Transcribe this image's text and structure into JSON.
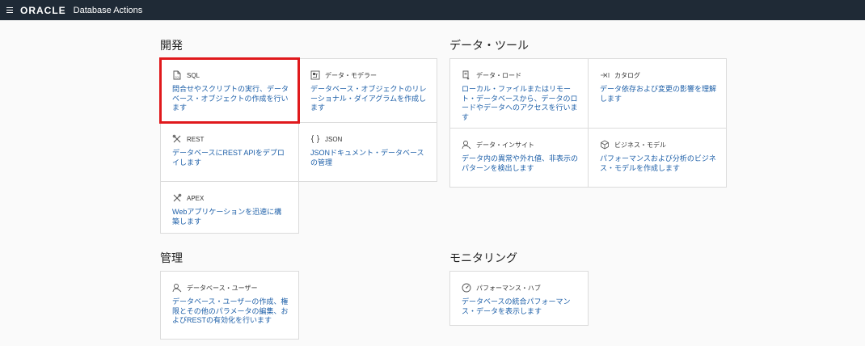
{
  "topbar": {
    "brand": "ORACLE",
    "app_title": "Database Actions"
  },
  "sections": {
    "development": {
      "title": "開発",
      "cards": [
        {
          "label": "SQL",
          "icon": "sql-file-icon",
          "desc": "問合せやスクリプトの実行、データベース・オブジェクトの作成を行います"
        },
        {
          "label": "データ・モデラー",
          "icon": "data-modeler-icon",
          "desc": "データベース・オブジェクトのリレーショナル・ダイアグラムを作成します"
        },
        {
          "label": "REST",
          "icon": "rest-tools-icon",
          "desc": "データベースにREST APIをデプロイします"
        },
        {
          "label": "JSON",
          "icon": "json-braces-icon",
          "desc": "JSONドキュメント・データベースの管理"
        },
        {
          "label": "APEX",
          "icon": "apex-tools-icon",
          "desc": "Webアプリケーションを迅速に構築します"
        }
      ]
    },
    "data_tools": {
      "title": "データ・ツール",
      "cards": [
        {
          "label": "データ・ロード",
          "icon": "data-load-icon",
          "desc": "ローカル・ファイルまたはリモート・データベースから、データのロードやデータへのアクセスを行います"
        },
        {
          "label": "カタログ",
          "icon": "catalog-icon",
          "desc": "データ依存および変更の影響を理解します"
        },
        {
          "label": "データ・インサイト",
          "icon": "data-insight-icon",
          "desc": "データ内の異常や外れ値、非表示のパターンを検出します"
        },
        {
          "label": "ビジネス・モデル",
          "icon": "business-model-icon",
          "desc": "パフォーマンスおよび分析のビジネス・モデルを作成します"
        }
      ]
    },
    "admin": {
      "title": "管理",
      "cards": [
        {
          "label": "データベース・ユーザー",
          "icon": "database-users-icon",
          "desc": "データベース・ユーザーの作成、権限とその他のパラメータの編集、およびRESTの有効化を行います"
        }
      ]
    },
    "monitoring": {
      "title": "モニタリング",
      "cards": [
        {
          "label": "パフォーマンス・ハブ",
          "icon": "performance-gauge-icon",
          "desc": "データベースの統合パフォーマンス・データを表示します"
        }
      ]
    }
  },
  "colors": {
    "topbar": "#1f2a36",
    "link": "#1d5fa8",
    "highlight": "#e0191c"
  }
}
